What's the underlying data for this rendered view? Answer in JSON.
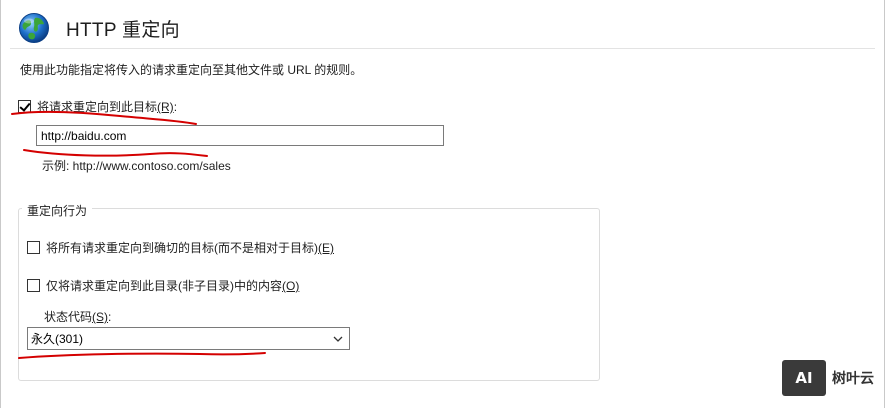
{
  "header": {
    "title": "HTTP 重定向",
    "icon": "globe-icon"
  },
  "description": "使用此功能指定将传入的请求重定向至其他文件或 URL 的规则。",
  "redirect_checkbox": {
    "label": "将请求重定向到此目标",
    "accesskey": "(R)",
    "suffix": ":",
    "checked": true
  },
  "target_input": {
    "value": "http://baidu.com"
  },
  "example": "示例: http://www.contoso.com/sales",
  "behavior_group": {
    "title": "重定向行为",
    "exact_destination": {
      "label": "将所有请求重定向到确切的目标(而不是相对于目标)",
      "accesskey": "(E)",
      "checked": false
    },
    "only_this_directory": {
      "label": "仅将请求重定向到此目录(非子目录)中的内容",
      "accesskey": "(O)",
      "checked": false
    },
    "status_code": {
      "label": "状态代码",
      "accesskey": "(S)",
      "suffix": ":",
      "selected": "永久(301)"
    }
  },
  "watermark": {
    "logo": "AI",
    "brand": "树叶云"
  },
  "colors": {
    "annotation": "#d40000",
    "globe_blue": "#1d6fc9",
    "globe_green": "#3aa53a"
  }
}
